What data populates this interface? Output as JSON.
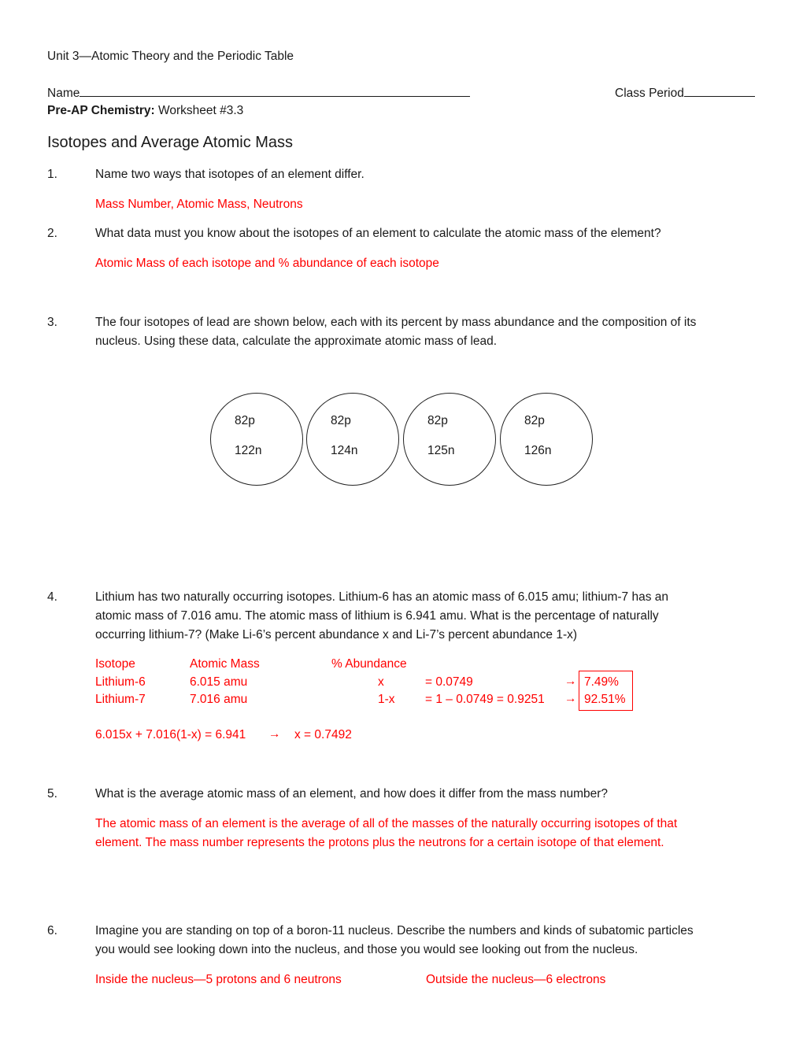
{
  "header": {
    "unit": "Unit 3—Atomic Theory and the Periodic Table",
    "name_label": "Name",
    "class_period_label": "Class Period",
    "course_bold": "Pre-AP Chemistry:",
    "worksheet": " Worksheet #3.3",
    "title": "Isotopes and Average Atomic Mass"
  },
  "colors": {
    "answer": "#ff0000",
    "text": "#1a1a1a"
  },
  "questions": [
    {
      "number": "1.",
      "text": "Name two ways that isotopes of an element differ.",
      "answer": "Mass Number, Atomic Mass, Neutrons"
    },
    {
      "number": "2.",
      "text": "What data must you know about the isotopes of an element to calculate the atomic mass of the element?",
      "answer": "Atomic Mass of each isotope and % abundance of each isotope"
    },
    {
      "number": "3.",
      "text_line1": "The four isotopes of lead are shown below, each with its percent by mass abundance and the composition of its",
      "text_line2": "nucleus.  Using these data, calculate the approximate atomic mass of lead.",
      "isotopes": [
        {
          "protons": "82p",
          "neutrons": "122n"
        },
        {
          "protons": "82p",
          "neutrons": "124n"
        },
        {
          "protons": "82p",
          "neutrons": "125n"
        },
        {
          "protons": "82p",
          "neutrons": "126n"
        }
      ]
    },
    {
      "number": "4.",
      "text_line1": "Lithium has two naturally occurring isotopes.  Lithium-6 has an atomic mass of 6.015 amu; lithium-7 has an",
      "text_line2": "atomic mass of 7.016 amu.  The atomic mass of lithium is 6.941 amu.  What is the percentage of naturally",
      "text_line3": "occurring lithium-7? (Make Li-6’s percent abundance x and Li-7’s percent abundance 1-x)",
      "table": {
        "headers": [
          "Isotope",
          "Atomic Mass",
          "% Abundance"
        ],
        "rows": [
          {
            "isotope": "Lithium-6",
            "mass": "6.015 amu",
            "abundance": "x",
            "calc": "= 0.0749",
            "arrow": "→",
            "result": "7.49%"
          },
          {
            "isotope": "Lithium-7",
            "mass": "7.016 amu",
            "abundance": "1-x",
            "calc": "= 1 – 0.0749 = 0.9251",
            "arrow": "→",
            "result": "92.51%"
          }
        ]
      },
      "equation": "6.015x + 7.016(1-x) = 6.941",
      "equation_arrow": "→",
      "equation_result": "x = 0.7492"
    },
    {
      "number": "5.",
      "text": "What is the average atomic mass of an element, and how does it differ from the mass number?",
      "answer_line1": "The atomic mass of an element is the average of all of the masses of the naturally occurring isotopes of that",
      "answer_line2": "element. The mass number represents the protons plus the neutrons for a certain isotope of that element."
    },
    {
      "number": "6.",
      "text_line1": "Imagine you are standing on top of a boron-11 nucleus.  Describe the numbers and kinds of subatomic particles",
      "text_line2": "you would see looking down into the nucleus, and those you would see looking out from the nucleus.",
      "answer_inside": "Inside the nucleus—5 protons and 6 neutrons",
      "answer_outside": "Outside the nucleus—6 electrons"
    }
  ]
}
